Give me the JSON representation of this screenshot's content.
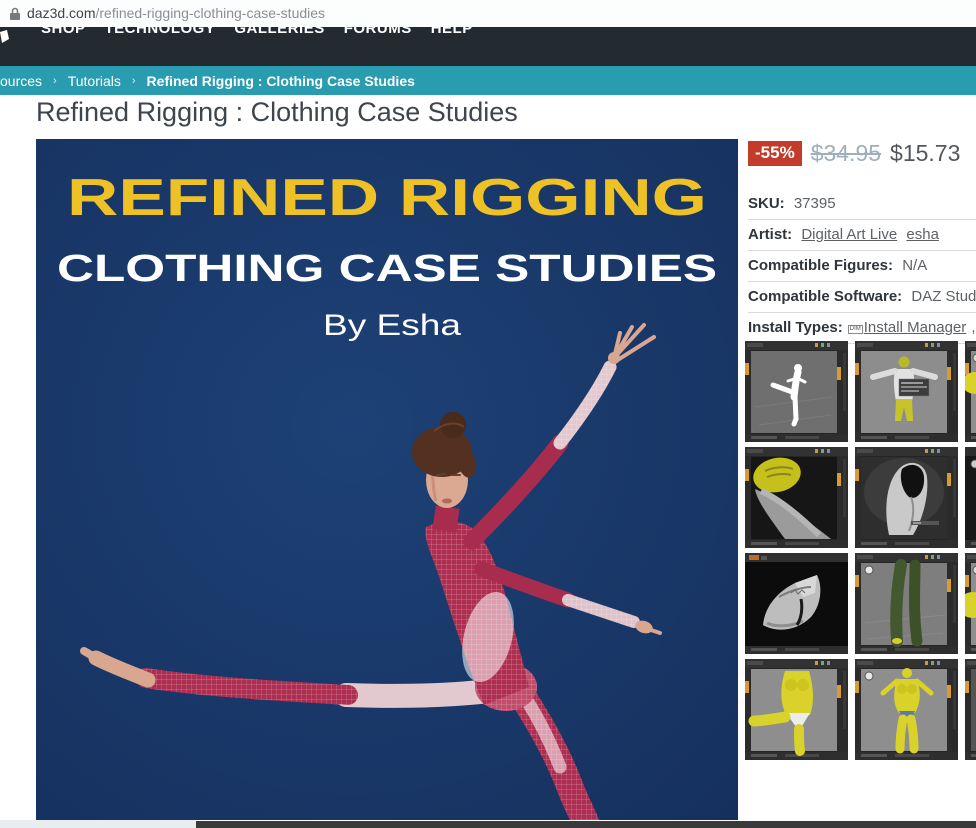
{
  "browser": {
    "url_domain": "daz3d.com",
    "url_path": "/refined-rigging-clothing-case-studies"
  },
  "nav": {
    "items": [
      "SHOP",
      "TECHNOLOGY",
      "GALLERIES",
      "FORUMS",
      "HELP"
    ]
  },
  "breadcrumb": {
    "items": [
      "ources",
      "Tutorials"
    ],
    "separator": "›",
    "current": "Refined Rigging : Clothing Case Studies"
  },
  "page": {
    "title": "Refined Rigging : Clothing Case Studies"
  },
  "hero": {
    "title_line1": "REFINED RIGGING",
    "title_line2": "CLOTHING CASE STUDIES",
    "byline": "By Esha",
    "bg_color": "#1a3a6c",
    "title_color": "#eec127"
  },
  "product": {
    "discount": "-55%",
    "old_price": "$34.95",
    "price": "$15.73",
    "sku_label": "SKU:",
    "sku": "37395",
    "artist_label": "Artist:",
    "artists": [
      "Digital Art Live",
      "esha"
    ],
    "figures_label": "Compatible Figures:",
    "figures": "N/A",
    "software_label": "Compatible Software:",
    "software": "DAZ Studio",
    "install_label": "Install Types:",
    "install_icon_text": "DIM",
    "install_link": "Install Manager",
    "install_suffix": ","
  },
  "colors": {
    "breadcrumb_bg": "#2a9cb0",
    "navbar_bg": "#242b30",
    "badge_red": "#c23b2b",
    "hero_navy": "#1a3a6c",
    "hero_gold": "#eec127"
  },
  "thumbnails": [
    {
      "name": "thumb-white-figure-dance-pose",
      "type": "dance"
    },
    {
      "name": "thumb-tpose-yellow-dialog",
      "type": "tpose"
    },
    {
      "name": "thumb-partial-1",
      "type": "sliver1"
    },
    {
      "name": "thumb-hip-closeup-yellow",
      "type": "hip"
    },
    {
      "name": "thumb-shoe-closeup",
      "type": "boot"
    },
    {
      "name": "thumb-partial-2",
      "type": "sliver2"
    },
    {
      "name": "thumb-cloth-ruffle-closeup",
      "type": "ruffle"
    },
    {
      "name": "thumb-green-leggings",
      "type": "leggings"
    },
    {
      "name": "thumb-partial-3",
      "type": "sliver3"
    },
    {
      "name": "thumb-yellow-figure-white-underwear",
      "type": "legraised"
    },
    {
      "name": "thumb-yellow-figure-blue-panties",
      "type": "bluepanties"
    },
    {
      "name": "thumb-partial-4",
      "type": "sliver4"
    }
  ]
}
